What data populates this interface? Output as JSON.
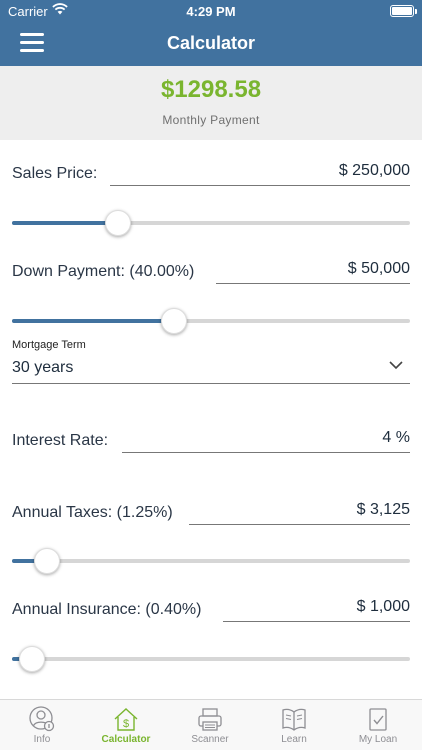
{
  "status": {
    "carrier": "Carrier",
    "time": "4:29 PM"
  },
  "nav": {
    "title": "Calculator",
    "menu_icon": "hamburger-menu-icon"
  },
  "summary": {
    "amount": "$1298.58",
    "label": "Monthly Payment",
    "amount_color": "#7ab52f"
  },
  "form": {
    "sales_price": {
      "label": "Sales Price:",
      "value": "$ 250,000",
      "slider_fraction": 0.25
    },
    "down_payment": {
      "label": "Down Payment: (40.00%)",
      "value": "$ 50,000",
      "slider_fraction": 0.4
    },
    "mortgage_term": {
      "label": "Mortgage Term",
      "value": "30 years"
    },
    "interest_rate": {
      "label": "Interest Rate:",
      "value": "4 %"
    },
    "annual_taxes": {
      "label": "Annual Taxes: (1.25%)",
      "value": "$ 3,125",
      "slider_fraction": 0.06
    },
    "annual_insurance": {
      "label": "Annual Insurance: (0.40%)",
      "value": "$ 1,000",
      "slider_fraction": 0.02
    }
  },
  "tabs": [
    {
      "label": "Info",
      "icon": "user-info-icon",
      "active": false
    },
    {
      "label": "Calculator",
      "icon": "house-dollar-icon",
      "active": true
    },
    {
      "label": "Scanner",
      "icon": "scanner-icon",
      "active": false
    },
    {
      "label": "Learn",
      "icon": "book-icon",
      "active": false
    },
    {
      "label": "My Loan",
      "icon": "document-check-icon",
      "active": false
    }
  ],
  "colors": {
    "nav_bar": "#41729f",
    "accent": "#7ab52f",
    "slider_fill": "#41729f"
  }
}
